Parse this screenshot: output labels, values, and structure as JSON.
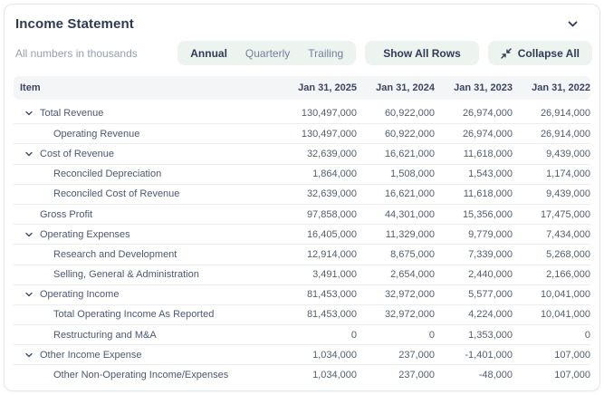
{
  "header": {
    "title": "Income Statement",
    "collapse_icon": "chevron-down"
  },
  "toolbar": {
    "note": "All numbers in thousands",
    "period_options": [
      {
        "label": "Annual",
        "selected": true
      },
      {
        "label": "Quarterly",
        "selected": false
      },
      {
        "label": "Trailing",
        "selected": false
      }
    ],
    "show_all_rows_label": "Show All Rows",
    "collapse_all_label": "Collapse All",
    "collapse_all_icon": "collapse-arrows-icon"
  },
  "table": {
    "item_header": "Item",
    "columns": [
      "Jan 31, 2025",
      "Jan 31, 2024",
      "Jan 31, 2023",
      "Jan 31, 2022"
    ],
    "rows": [
      {
        "label": "Total Revenue",
        "level": 0,
        "expandable": true,
        "values": [
          "130,497,000",
          "60,922,000",
          "26,974,000",
          "26,914,000"
        ]
      },
      {
        "label": "Operating Revenue",
        "level": 1,
        "expandable": false,
        "values": [
          "130,497,000",
          "60,922,000",
          "26,974,000",
          "26,914,000"
        ]
      },
      {
        "label": "Cost of Revenue",
        "level": 0,
        "expandable": true,
        "values": [
          "32,639,000",
          "16,621,000",
          "11,618,000",
          "9,439,000"
        ]
      },
      {
        "label": "Reconciled Depreciation",
        "level": 1,
        "expandable": false,
        "values": [
          "1,864,000",
          "1,508,000",
          "1,543,000",
          "1,174,000"
        ]
      },
      {
        "label": "Reconciled Cost of Revenue",
        "level": 1,
        "expandable": false,
        "values": [
          "32,639,000",
          "16,621,000",
          "11,618,000",
          "9,439,000"
        ]
      },
      {
        "label": "Gross Profit",
        "level": 0,
        "expandable": false,
        "values": [
          "97,858,000",
          "44,301,000",
          "15,356,000",
          "17,475,000"
        ]
      },
      {
        "label": "Operating Expenses",
        "level": 0,
        "expandable": true,
        "values": [
          "16,405,000",
          "11,329,000",
          "9,779,000",
          "7,434,000"
        ]
      },
      {
        "label": "Research and Development",
        "level": 1,
        "expandable": false,
        "values": [
          "12,914,000",
          "8,675,000",
          "7,339,000",
          "5,268,000"
        ]
      },
      {
        "label": "Selling, General & Administration",
        "level": 1,
        "expandable": false,
        "values": [
          "3,491,000",
          "2,654,000",
          "2,440,000",
          "2,166,000"
        ]
      },
      {
        "label": "Operating Income",
        "level": 0,
        "expandable": true,
        "values": [
          "81,453,000",
          "32,972,000",
          "5,577,000",
          "10,041,000"
        ]
      },
      {
        "label": "Total Operating Income As Reported",
        "level": 1,
        "expandable": false,
        "values": [
          "81,453,000",
          "32,972,000",
          "4,224,000",
          "10,041,000"
        ]
      },
      {
        "label": "Restructuring and M&A",
        "level": 1,
        "expandable": false,
        "values": [
          "0",
          "0",
          "1,353,000",
          "0"
        ]
      },
      {
        "label": "Other Income Expense",
        "level": 0,
        "expandable": true,
        "values": [
          "1,034,000",
          "237,000",
          "-1,401,000",
          "107,000"
        ]
      },
      {
        "label": "Other Non-Operating Income/Expenses",
        "level": 1,
        "expandable": false,
        "values": [
          "1,034,000",
          "237,000",
          "-48,000",
          "107,000"
        ]
      }
    ]
  },
  "colors": {
    "card_border": "#e4e7ea",
    "title_text": "#2e3a52",
    "muted_text": "#94a0ae",
    "button_bg": "#edf3ef",
    "button_text": "#2f3c55",
    "table_header_bg": "#f3f5f7",
    "row_label_text": "#4b5871",
    "cell_text": "#525e6e",
    "row_separator": "#ebedf0"
  }
}
